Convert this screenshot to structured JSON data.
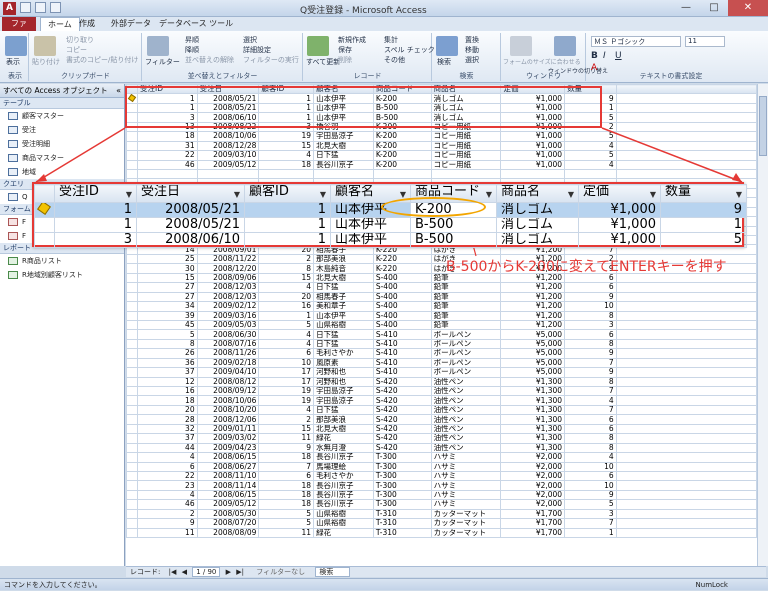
{
  "window": {
    "title": "Q受注登録 - Microsoft Access"
  },
  "tabs": [
    "ファイル",
    "ホーム",
    "作成",
    "外部データ",
    "データベース ツール"
  ],
  "ribbon": {
    "groups": [
      {
        "label": "表示",
        "buttons": [
          "表示"
        ]
      },
      {
        "label": "クリップボード",
        "buttons": [
          "貼り付け",
          "切り取り",
          "コピー",
          "書式のコピー/貼り付け"
        ]
      },
      {
        "label": "並べ替えとフィルター",
        "buttons": [
          "フィルター",
          "昇順",
          "降順",
          "並べ替えの解除",
          "選択",
          "詳細設定",
          "フィルターの実行"
        ]
      },
      {
        "label": "レコード",
        "buttons": [
          "すべて更新",
          "新規作成",
          "保存",
          "削除",
          "集計",
          "スペル チェック",
          "その他"
        ]
      },
      {
        "label": "検索",
        "buttons": [
          "検索",
          "置換",
          "移動",
          "選択"
        ]
      },
      {
        "label": "ウィンドウ",
        "buttons": [
          "フォームのサイズに合わせる",
          "ウィンドウの切り替え"
        ]
      },
      {
        "label": "テキストの書式設定",
        "buttons": [
          "ＭＳ Ｐゴシック",
          "11"
        ]
      }
    ]
  },
  "nav": {
    "title": "すべての Access オブジェクト",
    "sections": [
      {
        "name": "テーブル",
        "items": [
          "顧客マスター",
          "受注",
          "受注明細",
          "商品マスター",
          "地域"
        ]
      },
      {
        "name": "クエリ",
        "items": [
          "Q"
        ]
      },
      {
        "name": "フォーム",
        "items": [
          "F",
          "F"
        ]
      },
      {
        "name": "レポート",
        "items": [
          "R商品リスト",
          "R地域別顧客リスト"
        ]
      }
    ]
  },
  "grid": {
    "headers": [
      "受注ID",
      "受注日",
      "顧客ID",
      "顧客名",
      "商品コード",
      "商品名",
      "定価",
      "数量"
    ],
    "rows": [
      [
        "1",
        "2008/05/21",
        "1",
        "山本伊平",
        "K-200",
        "消しゴム",
        "¥1,000",
        "9"
      ],
      [
        "1",
        "2008/05/21",
        "1",
        "山本伊平",
        "B-500",
        "消しゴム",
        "¥1,000",
        "1"
      ],
      [
        "3",
        "2008/06/10",
        "1",
        "山本伊平",
        "B-500",
        "消しゴム",
        "¥1,000",
        "5"
      ],
      [
        "13",
        "2008/08/22",
        "3",
        "橋谷羽",
        "K-200",
        "コピー用紙",
        "¥1,000",
        "2"
      ],
      [
        "18",
        "2008/10/06",
        "19",
        "宇田島涼子",
        "K-200",
        "コピー用紙",
        "¥1,000",
        "5"
      ],
      [
        "31",
        "2008/12/28",
        "15",
        "北見大樹",
        "K-200",
        "コピー用紙",
        "¥1,000",
        "4"
      ],
      [
        "22",
        "2009/03/10",
        "4",
        "日下猛",
        "K-200",
        "コピー用紙",
        "¥1,000",
        "5"
      ],
      [
        "46",
        "2009/05/12",
        "18",
        "長谷川京子",
        "K-200",
        "コピー用紙",
        "¥1,000",
        "4"
      ],
      [
        "",
        "",
        "",
        "",
        "",
        "",
        "",
        ""
      ],
      [
        "",
        "",
        "",
        "",
        "",
        "",
        "",
        ""
      ],
      [
        "",
        "",
        "",
        "",
        "",
        "",
        "",
        ""
      ],
      [
        "",
        "",
        "",
        "",
        "",
        "",
        "",
        ""
      ],
      [
        "",
        "",
        "",
        "",
        "",
        "",
        "",
        ""
      ],
      [
        "",
        "",
        "",
        "",
        "",
        "",
        "",
        ""
      ],
      [
        "",
        "",
        "",
        "",
        "",
        "",
        "",
        ""
      ],
      [
        "",
        "",
        "",
        "",
        "",
        "",
        "",
        ""
      ],
      [
        "14",
        "2008/09/01",
        "20",
        "相馬春子",
        "K-220",
        "はがき",
        "¥1,200",
        "7"
      ],
      [
        "25",
        "2008/11/22",
        "2",
        "那部美浪",
        "K-220",
        "はがき",
        "¥1,200",
        "2"
      ],
      [
        "30",
        "2008/12/20",
        "8",
        "木島純音",
        "K-220",
        "はがき",
        "¥1,200",
        "9"
      ],
      [
        "15",
        "2008/09/06",
        "15",
        "北見大樹",
        "S-400",
        "鉛筆",
        "¥1,200",
        "6"
      ],
      [
        "27",
        "2008/12/03",
        "4",
        "日下猛",
        "S-400",
        "鉛筆",
        "¥1,200",
        "6"
      ],
      [
        "27",
        "2008/12/03",
        "20",
        "相馬春子",
        "S-400",
        "鉛筆",
        "¥1,200",
        "9"
      ],
      [
        "34",
        "2009/02/12",
        "16",
        "美和章子",
        "S-400",
        "鉛筆",
        "¥1,200",
        "10"
      ],
      [
        "39",
        "2009/03/16",
        "1",
        "山本伊平",
        "S-400",
        "鉛筆",
        "¥1,200",
        "8"
      ],
      [
        "45",
        "2009/05/03",
        "5",
        "山県裕樹",
        "S-400",
        "鉛筆",
        "¥1,200",
        "3"
      ],
      [
        "5",
        "2008/06/30",
        "4",
        "日下猛",
        "S-410",
        "ボールペン",
        "¥5,000",
        "6"
      ],
      [
        "8",
        "2008/07/16",
        "4",
        "日下猛",
        "S-410",
        "ボールペン",
        "¥5,000",
        "8"
      ],
      [
        "26",
        "2008/11/26",
        "6",
        "毛利さやか",
        "S-410",
        "ボールペン",
        "¥5,000",
        "9"
      ],
      [
        "36",
        "2009/02/18",
        "10",
        "風原素",
        "S-410",
        "ボールペン",
        "¥5,000",
        "7"
      ],
      [
        "37",
        "2009/04/10",
        "17",
        "河野和也",
        "S-410",
        "ボールペン",
        "¥5,000",
        "9"
      ],
      [
        "12",
        "2008/08/12",
        "17",
        "河野和也",
        "S-420",
        "油性ペン",
        "¥1,300",
        "8"
      ],
      [
        "16",
        "2008/09/12",
        "19",
        "宇田島涼子",
        "S-420",
        "油性ペン",
        "¥1,300",
        "7"
      ],
      [
        "18",
        "2008/10/06",
        "19",
        "宇田島涼子",
        "S-420",
        "油性ペン",
        "¥1,300",
        "4"
      ],
      [
        "20",
        "2008/10/20",
        "4",
        "日下猛",
        "S-420",
        "油性ペン",
        "¥1,300",
        "7"
      ],
      [
        "28",
        "2008/12/06",
        "2",
        "那部美浪",
        "S-420",
        "油性ペン",
        "¥1,300",
        "6"
      ],
      [
        "32",
        "2009/01/11",
        "15",
        "北見大樹",
        "S-420",
        "油性ペン",
        "¥1,300",
        "6"
      ],
      [
        "37",
        "2009/03/02",
        "11",
        "緑花",
        "S-420",
        "油性ペン",
        "¥1,300",
        "8"
      ],
      [
        "44",
        "2009/04/23",
        "9",
        "水無月澄",
        "S-420",
        "油性ペン",
        "¥1,300",
        "8"
      ],
      [
        "4",
        "2008/06/15",
        "18",
        "長谷川京子",
        "T-300",
        "ハサミ",
        "¥2,000",
        "4"
      ],
      [
        "6",
        "2008/06/27",
        "7",
        "馬場理絵",
        "T-300",
        "ハサミ",
        "¥2,000",
        "10"
      ],
      [
        "22",
        "2008/11/10",
        "6",
        "毛利さやか",
        "T-300",
        "ハサミ",
        "¥2,000",
        "6"
      ],
      [
        "23",
        "2008/11/14",
        "18",
        "長谷川京子",
        "T-300",
        "ハサミ",
        "¥2,000",
        "10"
      ],
      [
        "4",
        "2008/06/15",
        "18",
        "長谷川京子",
        "T-300",
        "ハサミ",
        "¥2,000",
        "9"
      ],
      [
        "46",
        "2009/05/12",
        "18",
        "長谷川京子",
        "T-300",
        "ハサミ",
        "¥2,000",
        "5"
      ],
      [
        "2",
        "2008/05/30",
        "5",
        "山県裕樹",
        "T-310",
        "カッターマット",
        "¥1,700",
        "3"
      ],
      [
        "9",
        "2008/07/20",
        "5",
        "山県裕樹",
        "T-310",
        "カッターマット",
        "¥1,700",
        "7"
      ],
      [
        "11",
        "2008/08/09",
        "11",
        "緑花",
        "T-310",
        "カッターマット",
        "¥1,700",
        "1"
      ]
    ]
  },
  "zoom": {
    "headers": [
      "受注ID",
      "受注日",
      "顧客ID",
      "顧客名",
      "商品コード",
      "商品名",
      "定価",
      "数量"
    ],
    "rows": [
      [
        "1",
        "2008/05/21",
        "1",
        "山本伊平",
        "K-200",
        "消しゴム",
        "¥1,000",
        "9"
      ],
      [
        "1",
        "2008/05/21",
        "1",
        "山本伊平",
        "B-500",
        "消しゴム",
        "¥1,000",
        "1"
      ],
      [
        "3",
        "2008/06/10",
        "1",
        "山本伊平",
        "B-500",
        "消しゴム",
        "¥1,000",
        "5"
      ]
    ]
  },
  "annotation": "B-500からK-200に変えてENTERキーを押す",
  "record_nav": {
    "label": "レコード:",
    "position": "1 / 90",
    "filter": "フィルターなし",
    "search": "検索"
  },
  "status": {
    "left": "コマンドを入力してください。",
    "right": "NumLock"
  }
}
